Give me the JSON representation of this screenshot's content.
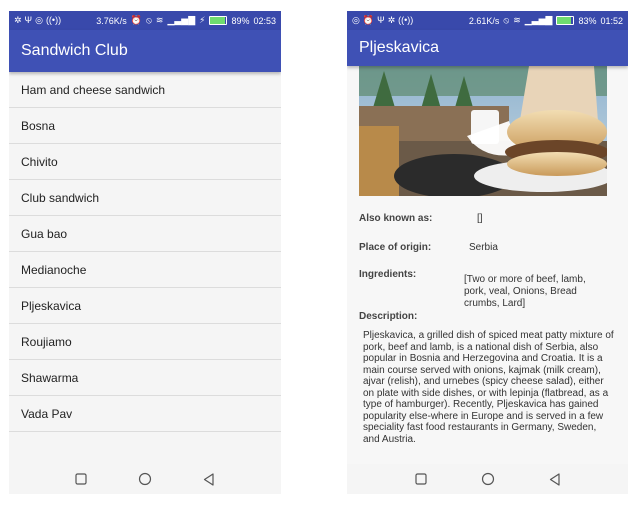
{
  "left": {
    "status": {
      "speed": "3.76K/s",
      "battery": "89%",
      "time": "02:53",
      "battery_level": 0.89
    },
    "title": "Sandwich Club",
    "items": [
      {
        "label": "Ham and cheese sandwich"
      },
      {
        "label": "Bosna"
      },
      {
        "label": "Chivito"
      },
      {
        "label": "Club sandwich"
      },
      {
        "label": "Gua bao"
      },
      {
        "label": "Medianoche"
      },
      {
        "label": "Pljeskavica"
      },
      {
        "label": "Roujiamo"
      },
      {
        "label": "Shawarma"
      },
      {
        "label": "Vada Pav"
      }
    ]
  },
  "right": {
    "status": {
      "speed": "2.61K/s",
      "battery": "83%",
      "time": "01:52",
      "battery_level": 0.83
    },
    "title": "Pljeskavica",
    "also_known_label": "Also known as:",
    "also_known_value": "[]",
    "origin_label": "Place of origin:",
    "origin_value": "Serbia",
    "ingredients_label": "Ingredients:",
    "ingredients_value": "[Two or more of beef, lamb, pork, veal, Onions, Bread crumbs, Lard]",
    "description_label": "Description:",
    "description_value": "Pljeskavica, a grilled dish of spiced meat patty mixture of pork, beef and lamb, is a national dish of Serbia, also popular in Bosnia and Herzegovina and Croatia. It is a main course served with onions, kajmak (milk cream), ajvar (relish), and urnebes (spicy cheese salad), either on plate with side dishes, or with lepinja (flatbread, as a type of hamburger). Recently, Pljeskavica has gained popularity else-where in Europe and is served in a few speciality fast food restaurants in Germany, Sweden, and Austria."
  },
  "icons": {
    "status_left": [
      "notification-icon",
      "usb-icon",
      "whatsapp-icon",
      "hotspot-icon"
    ],
    "status_right": [
      "signal-icon",
      "alarm-icon",
      "mute-icon",
      "wifi-icon",
      "battery-icon"
    ],
    "nav": [
      "recents-square-icon",
      "home-circle-icon",
      "back-triangle-icon"
    ]
  },
  "colors": {
    "statusbar": "#3949ab",
    "appbar": "#3f51b5",
    "battery_fill": "#6fdc6f"
  }
}
